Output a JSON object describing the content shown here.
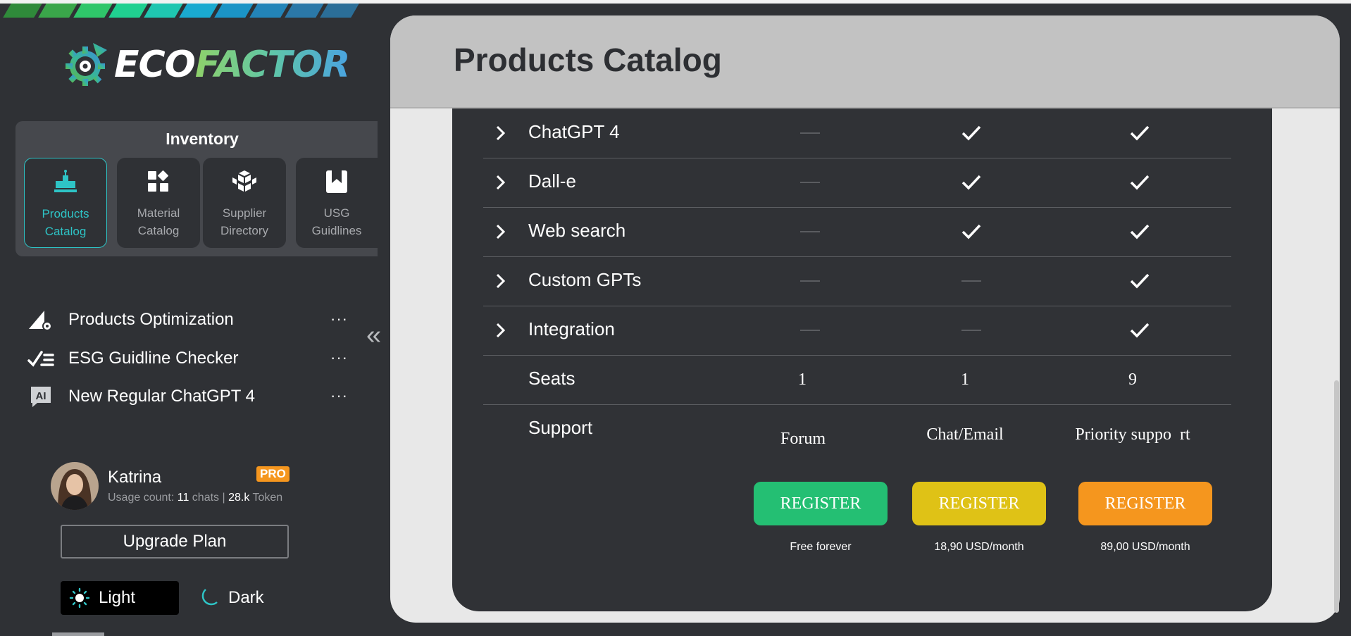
{
  "brand": {
    "eco": "ECO",
    "factor": "FACTOR"
  },
  "inventory": {
    "title": "Inventory",
    "items": [
      {
        "line1": "Products",
        "line2": "Catalog",
        "icon": "products-catalog-icon",
        "active": true
      },
      {
        "line1": "Material",
        "line2": "Catalog",
        "icon": "material-catalog-icon",
        "active": false
      },
      {
        "line1": "Supplier",
        "line2": "Directory",
        "icon": "supplier-directory-icon",
        "active": false
      },
      {
        "line1": "USG",
        "line2": "Guidlines",
        "icon": "usg-guidelines-icon",
        "active": false
      }
    ]
  },
  "menu": [
    {
      "label": "Products Optimization",
      "icon": "optimization-icon",
      "more": "···"
    },
    {
      "label": "ESG Guidline Checker",
      "icon": "checklist-icon",
      "more": "···"
    },
    {
      "label": "New Regular ChatGPT 4",
      "icon": "ai-chat-icon",
      "more": "···"
    }
  ],
  "collapse_glyph": "«",
  "user": {
    "name": "Katrina",
    "badge": "PRO",
    "usage_prefix": "Usage count: ",
    "chats_count": "11",
    "chats_label": " chats | ",
    "tokens_count": "28.k",
    "tokens_label": " Token"
  },
  "upgrade_label": "Upgrade Plan",
  "theme": {
    "light": "Light",
    "dark": "Dark"
  },
  "page_title": "Products Catalog",
  "features": [
    {
      "label": "ChatGPT 4",
      "free": "dash",
      "mid": "check",
      "top": "check"
    },
    {
      "label": "Dall-e",
      "free": "dash",
      "mid": "check",
      "top": "check"
    },
    {
      "label": "Web search",
      "free": "dash",
      "mid": "check",
      "top": "check"
    },
    {
      "label": "Custom GPTs",
      "free": "dash",
      "mid": "dash",
      "top": "check"
    },
    {
      "label": "Integration",
      "free": "dash",
      "mid": "dash",
      "top": "check"
    }
  ],
  "seats": {
    "label": "Seats",
    "values": [
      "1",
      "1",
      "9"
    ]
  },
  "support": {
    "label": "Support",
    "values": [
      "Forum",
      "Chat/Email",
      "Priority suppo  rt"
    ]
  },
  "plans": [
    {
      "button": "REGISTER",
      "price": "Free forever",
      "color": "#24bf73"
    },
    {
      "button": "REGISTER",
      "price": "18,90 USD/month",
      "color": "#dfc216"
    },
    {
      "button": "REGISTER",
      "price": "89,00 USD/month",
      "color": "#f5961e"
    }
  ]
}
